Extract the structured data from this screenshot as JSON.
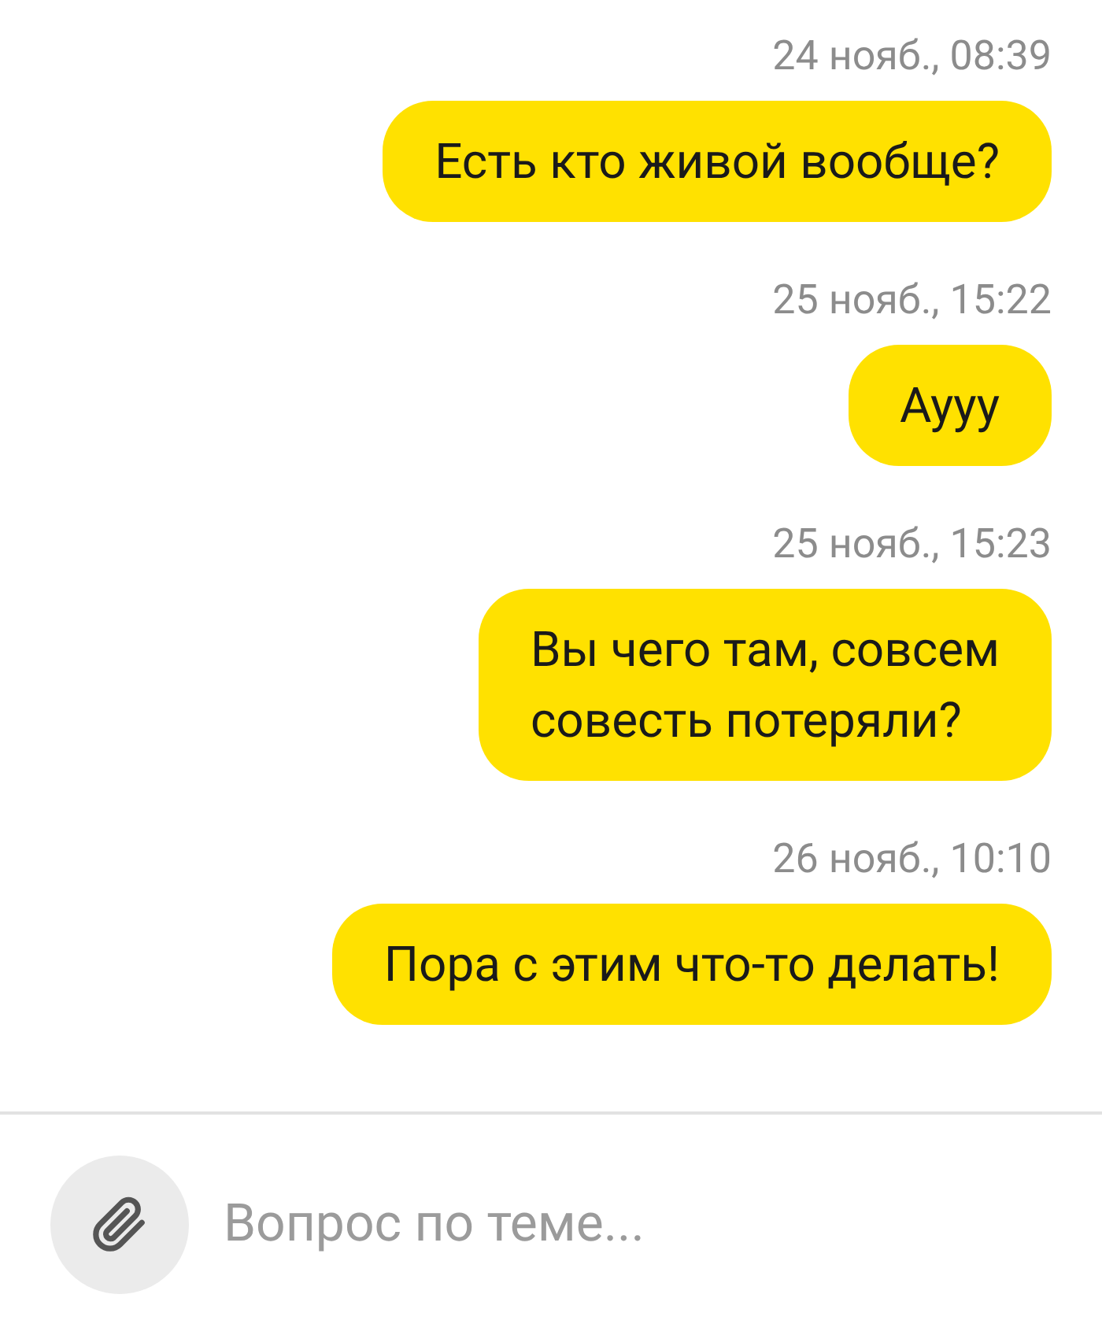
{
  "messages": [
    {
      "time": "24 нояб., 08:39",
      "text": "Есть кто живой вообще?"
    },
    {
      "time": "25 нояб., 15:22",
      "text": "Аууу"
    },
    {
      "time": "25 нояб., 15:23",
      "text": "Вы чего там, совсем\nсовесть потеряли?"
    },
    {
      "time": "26 нояб., 10:10",
      "text": "Пора с этим что-то делать!"
    }
  ],
  "composer": {
    "placeholder": "Вопрос по теме..."
  }
}
